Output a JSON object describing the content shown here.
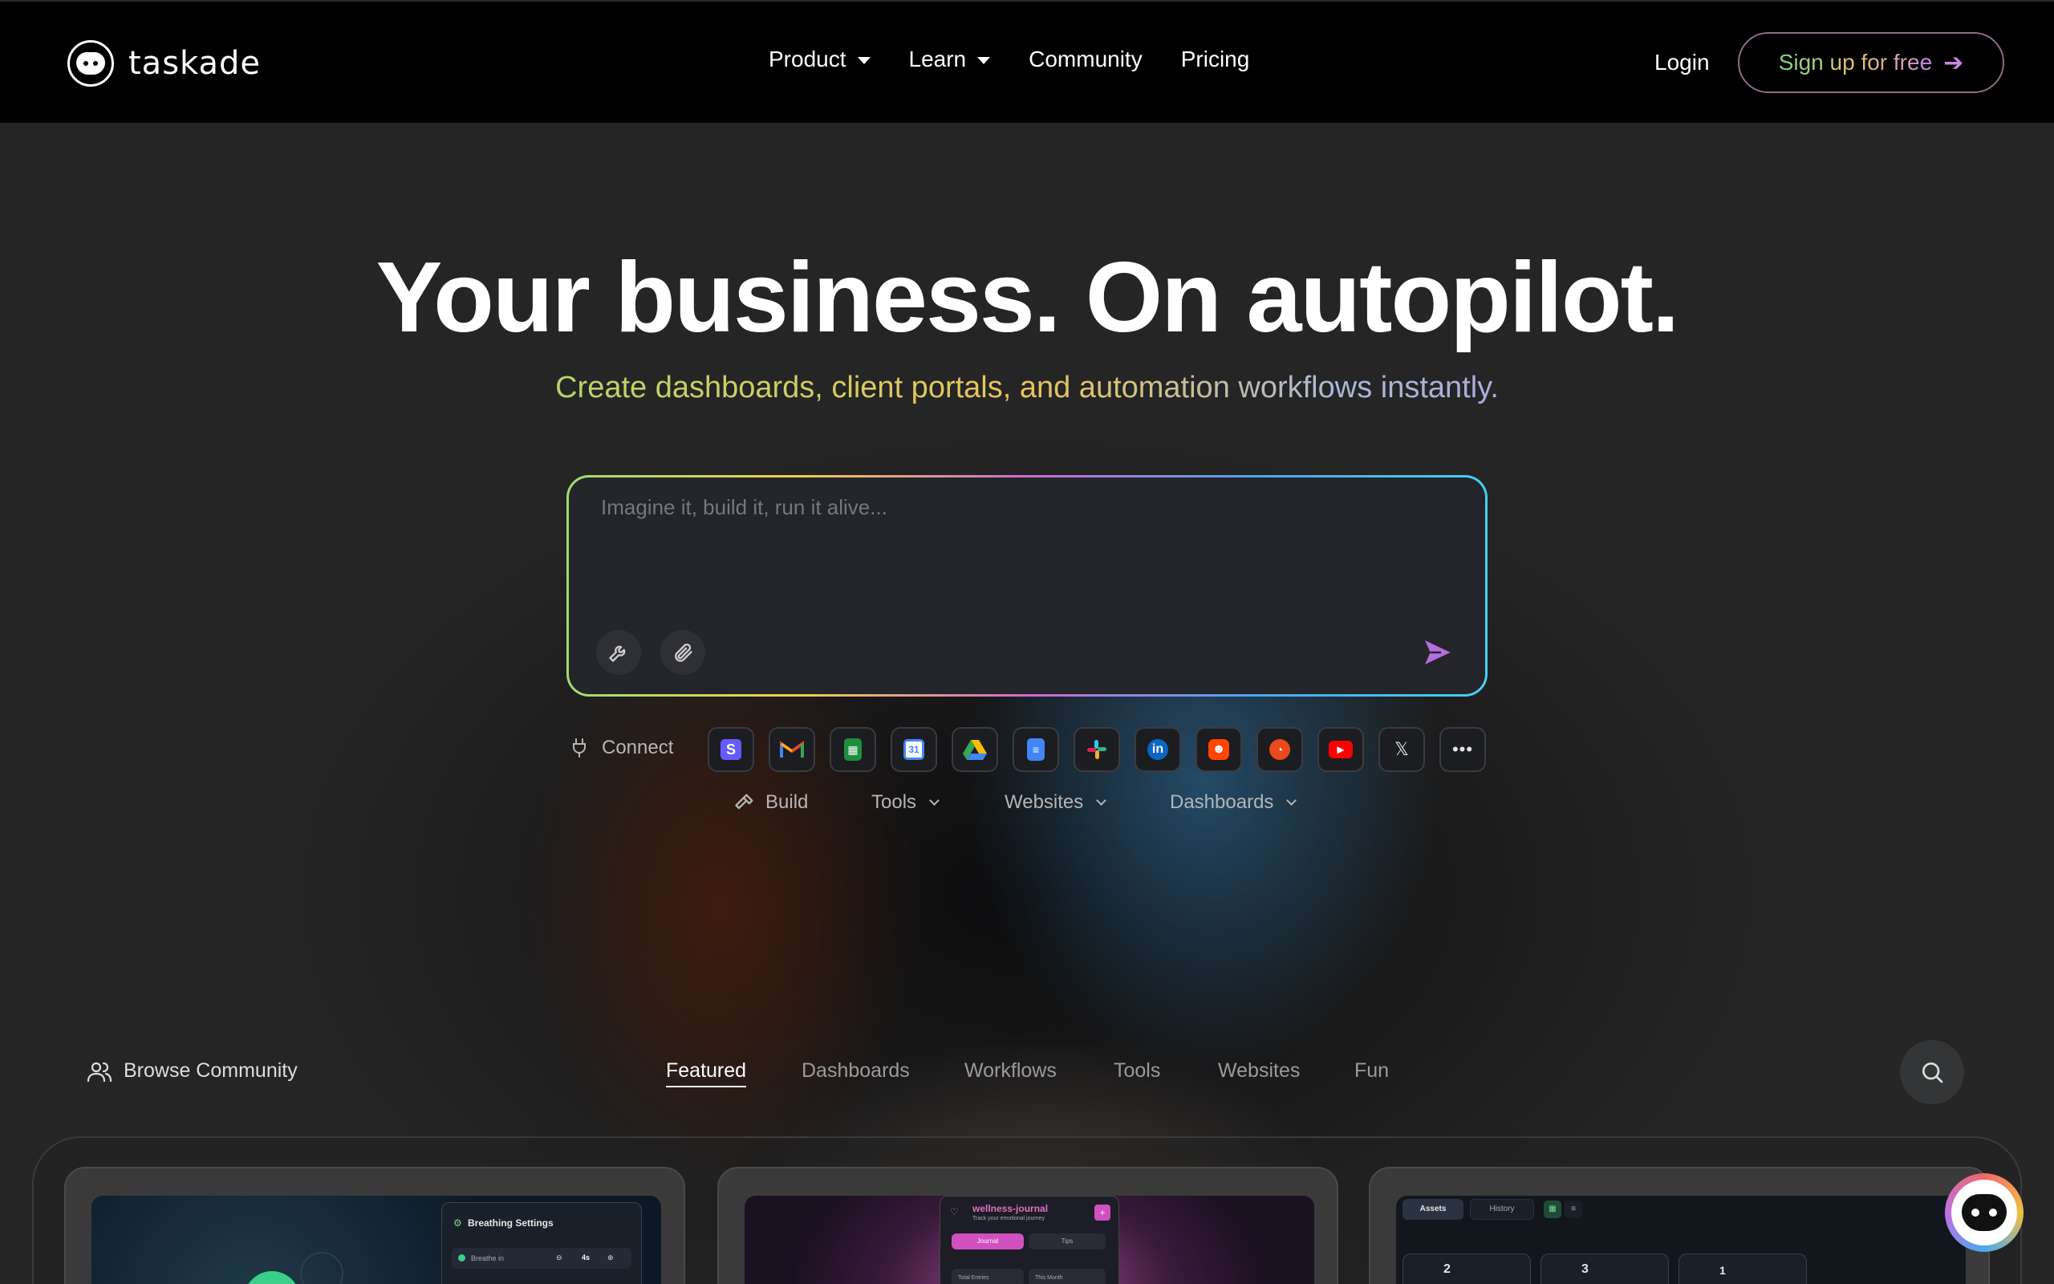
{
  "header": {
    "brand": "taskade",
    "nav": [
      {
        "label": "Product",
        "has_menu": true
      },
      {
        "label": "Learn",
        "has_menu": true
      },
      {
        "label": "Community",
        "has_menu": false
      },
      {
        "label": "Pricing",
        "has_menu": false
      }
    ],
    "login": "Login",
    "signup": "Sign up for free"
  },
  "hero": {
    "title": "Your business. On autopilot.",
    "subtitle": "Create dashboards, client portals, and automation workflows instantly.",
    "prompt_placeholder": "Imagine it, build it, run it alive..."
  },
  "connect": {
    "label": "Connect",
    "apps": [
      "stripe-icon",
      "gmail-icon",
      "google-sheets-icon",
      "google-calendar-icon",
      "google-drive-icon",
      "google-docs-icon",
      "slack-icon",
      "linkedin-icon",
      "reddit-icon",
      "rss-icon",
      "youtube-icon",
      "x-icon",
      "more-icon"
    ]
  },
  "build_row": {
    "build": "Build",
    "tools": "Tools",
    "websites": "Websites",
    "dashboards": "Dashboards"
  },
  "community": {
    "browse": "Browse Community",
    "tabs": [
      "Featured",
      "Dashboards",
      "Workflows",
      "Tools",
      "Websites",
      "Fun"
    ],
    "active_tab": "Featured"
  },
  "cards": {
    "card1": {
      "title": "Breathing Settings",
      "row_label": "Breathe in",
      "row_value": "4s"
    },
    "card2": {
      "title": "wellness-journal",
      "subtitle": "Track your emotional journey",
      "tab_a": "Journal",
      "tab_b": "Tips",
      "stat_a": "Total Entries",
      "stat_b": "This Month"
    },
    "card3": {
      "tab_a": "Assets",
      "tab_b": "History",
      "stats": [
        "2",
        "3",
        "1"
      ]
    }
  },
  "colors": {
    "accent_purple": "#c987e6",
    "accent_green": "#7ed28c",
    "accent_gold": "#e6c068"
  }
}
